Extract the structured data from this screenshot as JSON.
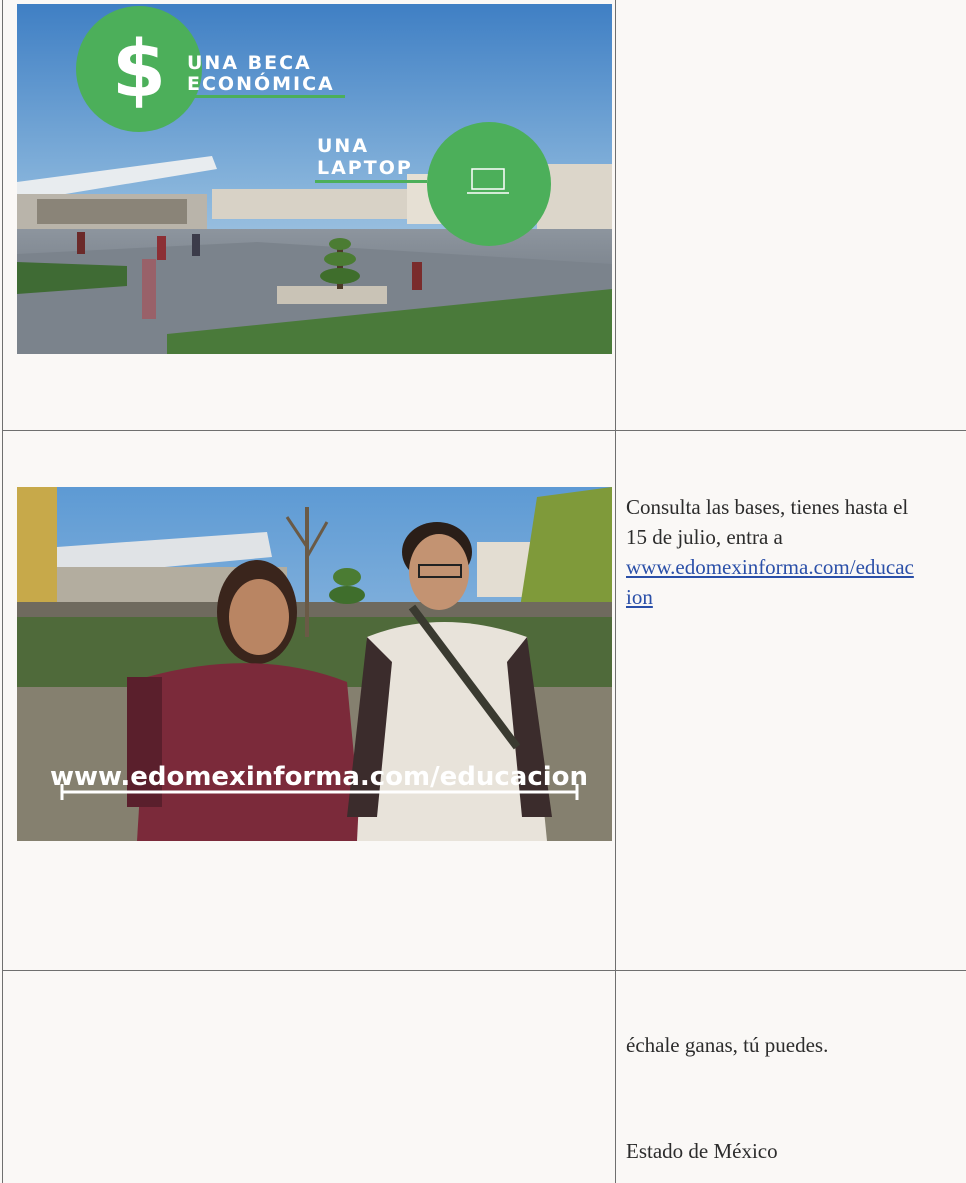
{
  "frame1": {
    "badge_line1": "UNA BECA",
    "badge_line2": "ECONÓMICA",
    "dollar_symbol": "$",
    "laptop_line1": "UNA",
    "laptop_line2": "LAPTOP",
    "accent_color": "#4caf5a"
  },
  "frame2": {
    "url_overlay": "www.edomexinforma.com/educacion"
  },
  "row2": {
    "text_line1": "Consulta las bases, tienes hasta el",
    "text_line2": "15 de julio, entra a",
    "link_line1": "www.edomexinforma.com/educac",
    "link_line2": "ion"
  },
  "row3": {
    "text": "échale ganas, tú puedes.",
    "footer": "Estado de México"
  }
}
